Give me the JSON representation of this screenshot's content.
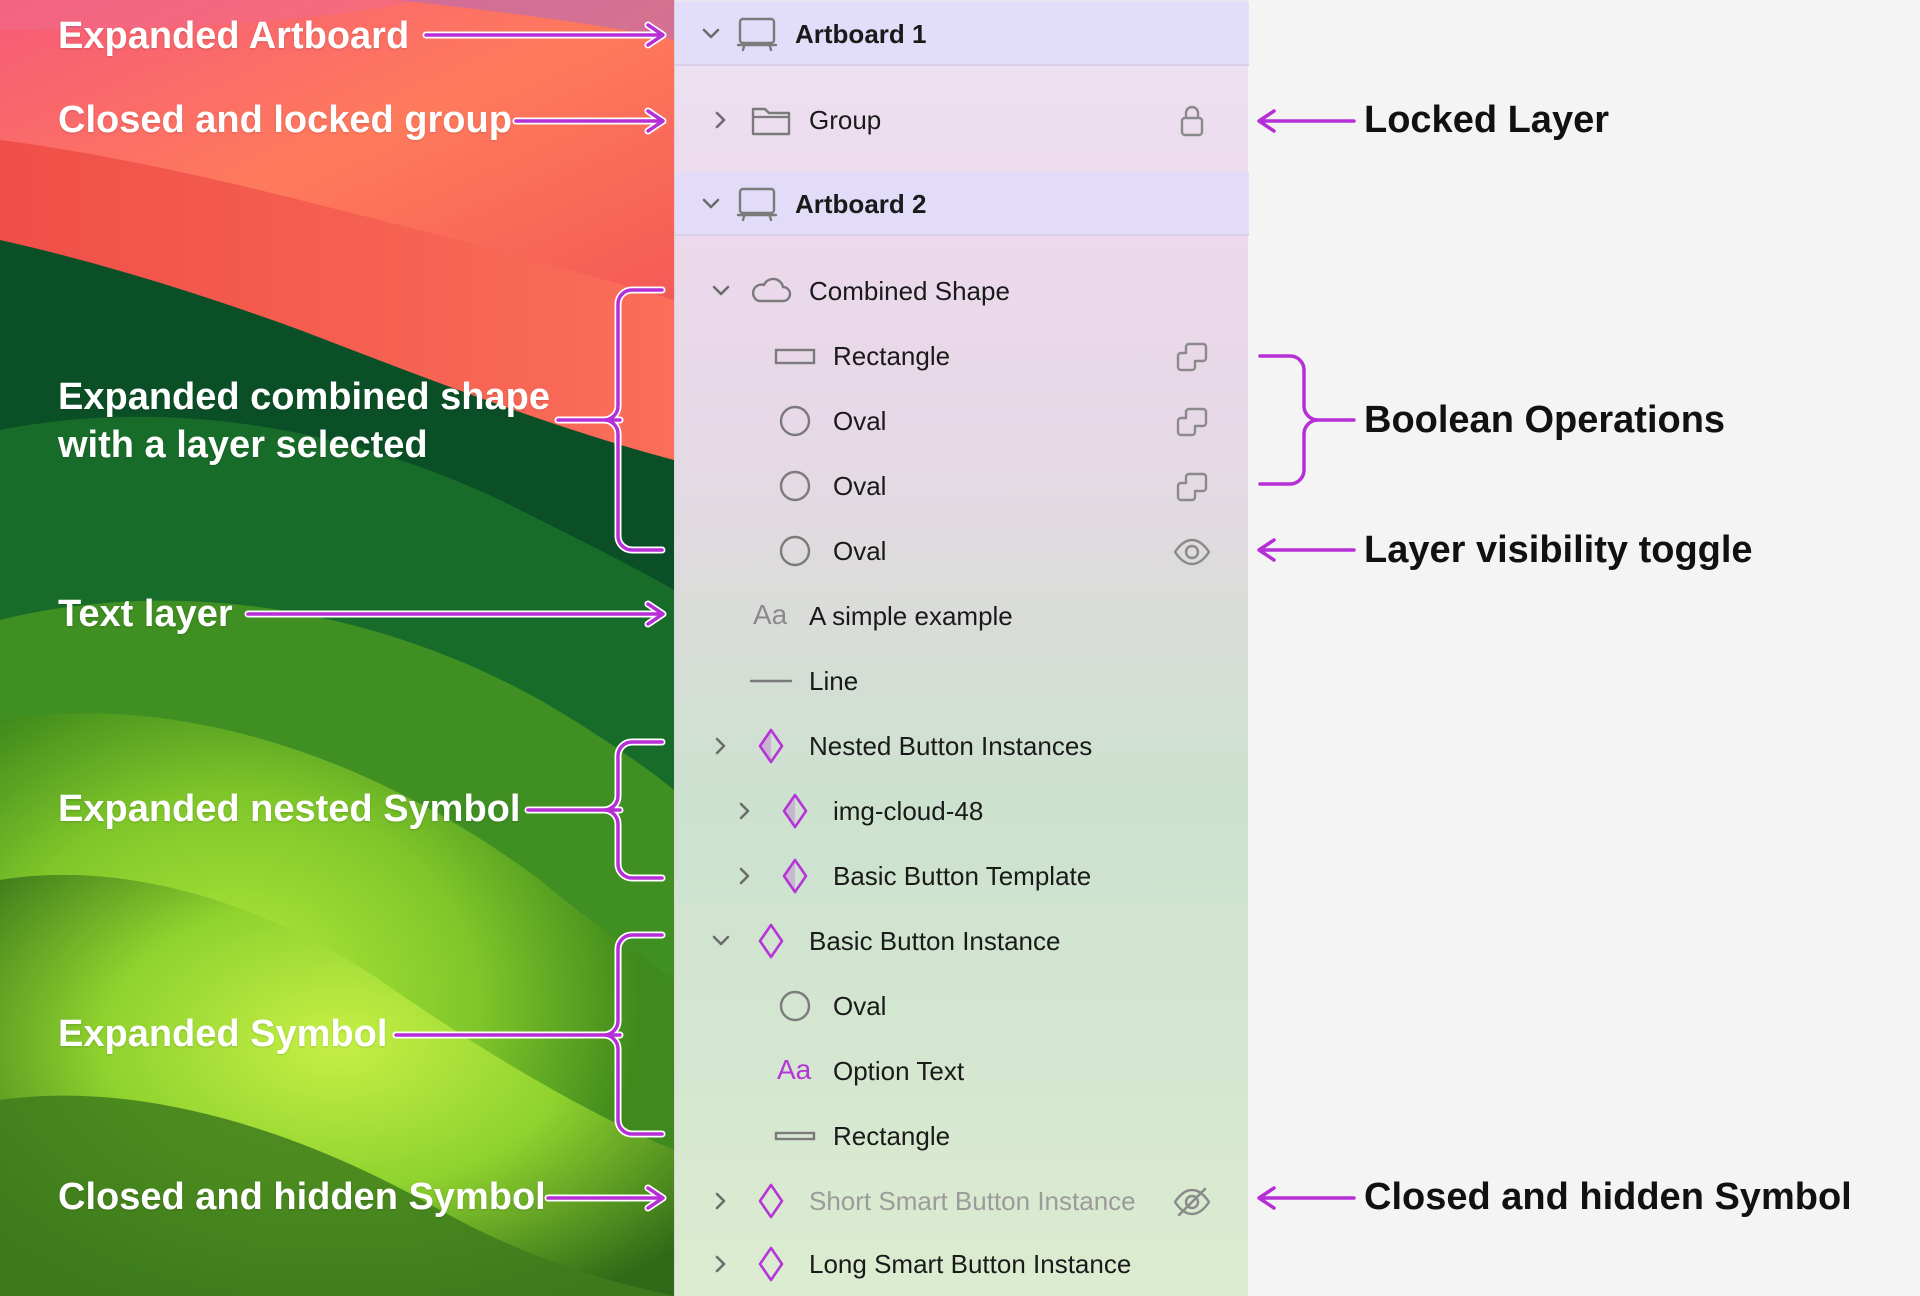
{
  "annotations_left": [
    {
      "text": "Expanded Artboard"
    },
    {
      "text": "Closed and locked group"
    },
    {
      "text": "Expanded combined shape\nwith a layer selected"
    },
    {
      "text": "Text layer"
    },
    {
      "text": "Expanded nested Symbol"
    },
    {
      "text": "Expanded Symbol"
    },
    {
      "text": "Closed and hidden Symbol"
    }
  ],
  "annotations_right": [
    {
      "text": "Locked Layer"
    },
    {
      "text": "Boolean Operations"
    },
    {
      "text": "Layer visibility toggle"
    },
    {
      "text": "Closed and hidden Symbol"
    }
  ],
  "layers": [
    {
      "label": "Artboard 1",
      "icon": "artboard-icon",
      "expand": "chevron-down-icon"
    },
    {
      "label": "Group",
      "icon": "folder-icon",
      "expand": "chevron-right-icon",
      "right_icon": "lock-icon"
    },
    {
      "label": "Artboard 2",
      "icon": "artboard-icon",
      "expand": "chevron-down-icon"
    },
    {
      "label": "Combined Shape",
      "icon": "cloud-icon",
      "expand": "chevron-down-icon"
    },
    {
      "label": "Rectangle",
      "icon": "rectangle-icon",
      "right_icon": "boolean-operation-icon"
    },
    {
      "label": "Oval",
      "icon": "oval-icon",
      "right_icon": "boolean-operation-icon"
    },
    {
      "label": "Oval",
      "icon": "oval-icon",
      "right_icon": "boolean-operation-icon"
    },
    {
      "label": "Oval",
      "icon": "oval-icon",
      "right_icon": "eye-icon"
    },
    {
      "label": "A simple example",
      "icon": "text-icon",
      "icon_text": "Aa"
    },
    {
      "label": "Line",
      "icon": "line-icon"
    },
    {
      "label": "Nested Button Instances",
      "icon": "symbol-icon",
      "expand": "chevron-right-icon"
    },
    {
      "label": "img-cloud-48",
      "icon": "symbol-icon",
      "expand": "chevron-right-icon"
    },
    {
      "label": "Basic Button Template",
      "icon": "symbol-icon",
      "expand": "chevron-right-icon"
    },
    {
      "label": "Basic Button Instance",
      "icon": "symbol-icon",
      "expand": "chevron-down-icon"
    },
    {
      "label": "Oval",
      "icon": "oval-icon"
    },
    {
      "label": "Option Text",
      "icon": "text-icon",
      "icon_text": "Aa"
    },
    {
      "label": "Rectangle",
      "icon": "thin-rectangle-icon"
    },
    {
      "label": "Short Smart Button Instance",
      "icon": "symbol-icon",
      "expand": "chevron-right-icon",
      "right_icon": "eye-slash-icon"
    },
    {
      "label": "Long Smart Button Instance",
      "icon": "symbol-icon",
      "expand": "chevron-right-icon"
    }
  ],
  "colors": {
    "accent_purple": "#b535d8",
    "icon_gray": "#7b7b7b",
    "panel_artboard_row": "#e1dcfa"
  }
}
